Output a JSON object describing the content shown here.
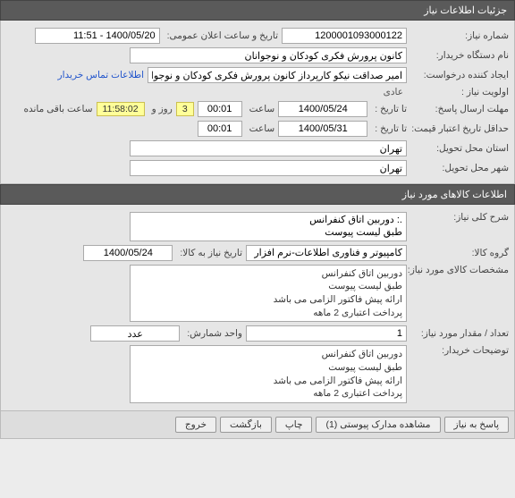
{
  "panel1": {
    "title": "جزئیات اطلاعات نیاز",
    "need_number_label": "شماره نیاز:",
    "need_number": "1200001093000122",
    "announce_label": "تاریخ و ساعت اعلان عمومی:",
    "announce_value": "1400/05/20 - 11:51",
    "buyer_org_label": "نام دستگاه خریدار:",
    "buyer_org": "کانون پرورش فکری کودکان و نوجوانان",
    "requester_label": "ایجاد کننده درخواست:",
    "requester": "امیر صداقت نیکو کارپرداز کانون پرورش فکری کودکان و نوجوانان",
    "contact_link": "اطلاعات تماس خریدار",
    "priority_label": "اولویت نیاز :",
    "priority": "عادی",
    "reply_deadline_label": "مهلت ارسال پاسخ:",
    "until_label": "تا تاریخ :",
    "reply_deadline_date": "1400/05/24",
    "time_label": "ساعت",
    "reply_deadline_time": "00:01",
    "remain_days": "3",
    "remain_days_label": "روز و",
    "remain_time": "11:58:02",
    "remain_suffix": "ساعت باقی مانده",
    "price_validity_label": "حداقل تاریخ اعتبار قیمت:",
    "price_validity_date": "1400/05/31",
    "price_validity_time": "00:01",
    "province_label": "استان محل تحویل:",
    "province": "تهران",
    "city_label": "شهر محل تحویل:",
    "city": "تهران"
  },
  "panel2": {
    "title": "اطلاعات کالاهای مورد نیاز",
    "general_desc_label": "شرح کلی نیاز:",
    "general_desc": ".: دوربین اتاق کنفرانس\nطبق لیست پیوست",
    "group_label": "گروه کالا:",
    "group": "کامپیوتر و فناوری اطلاعات-نرم افزار",
    "need_date_label": "تاریخ نیاز به کالا:",
    "need_date": "1400/05/24",
    "spec_label": "مشخصات کالای مورد نیاز:",
    "spec": "دوربین اتاق کنفرانس\nطبق لیست پیوست\nارائه پیش فاکتور الزامی می باشد\nپرداخت اعتباری 2 ماهه",
    "qty_label": "تعداد / مقدار مورد نیاز:",
    "qty": "1",
    "unit_label": "واحد شمارش:",
    "unit": "عدد",
    "buyer_notes_label": "توضیحات خریدار:",
    "buyer_notes": "دوربین اتاق کنفرانس\nطبق لیست پیوست\nارائه پیش فاکتور الزامی می باشد\nپرداخت اعتباری 2 ماهه"
  },
  "buttons": {
    "respond": "پاسخ به نیاز",
    "attachments": "مشاهده مدارک پیوستی (1)",
    "print": "چاپ",
    "back": "بازگشت",
    "exit": "خروج"
  }
}
